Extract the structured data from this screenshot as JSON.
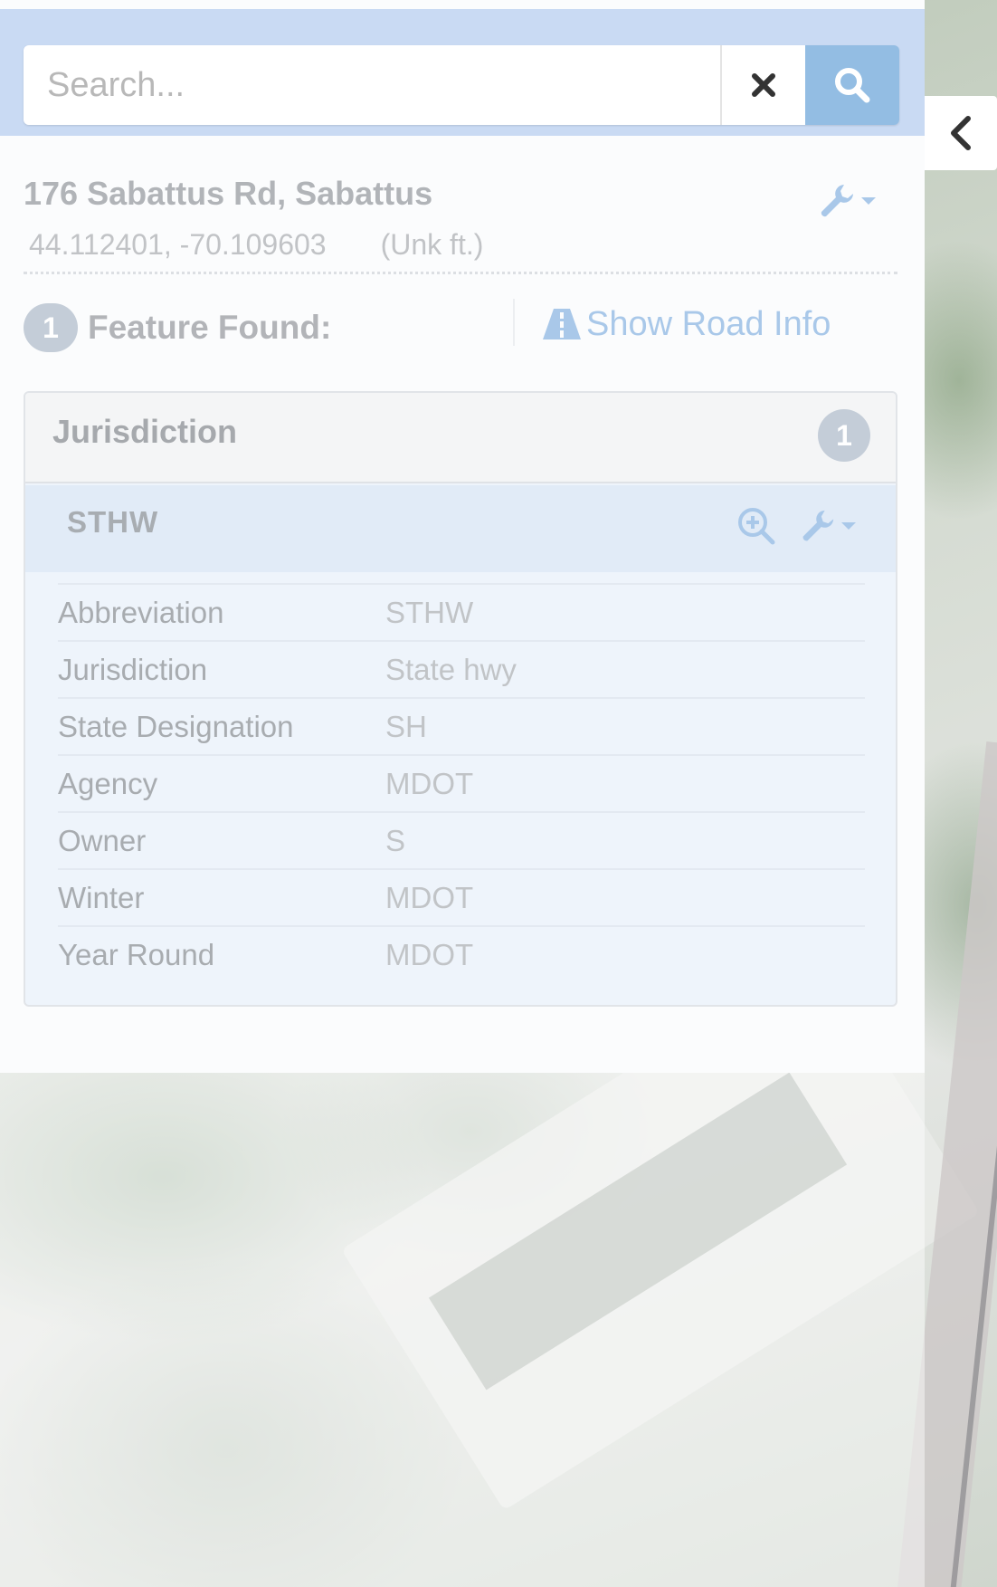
{
  "search": {
    "placeholder": "Search...",
    "clear_icon": "close-icon",
    "search_icon": "search-icon"
  },
  "location": {
    "address": "176 Sabattus Rd, Sabattus",
    "coordinates": "44.112401, -70.109603",
    "elevation": "(Unk ft.)",
    "tools_icon": "wrench-icon"
  },
  "features": {
    "count": "1",
    "label": "Feature Found:",
    "road_info_label": "Show Road Info",
    "road_info_icon": "road-icon"
  },
  "jurisdiction_card": {
    "title": "Jurisdiction",
    "count": "1",
    "item": {
      "title": "STHW",
      "zoom_icon": "zoom-in-icon",
      "tools_icon": "wrench-icon"
    },
    "rows": [
      {
        "label": "Abbreviation",
        "value": "STHW"
      },
      {
        "label": "Jurisdiction",
        "value": "State hwy"
      },
      {
        "label": "State Designation",
        "value": "SH"
      },
      {
        "label": "Agency",
        "value": "MDOT"
      },
      {
        "label": "Owner",
        "value": "S"
      },
      {
        "label": "Winter",
        "value": "MDOT"
      },
      {
        "label": "Year Round",
        "value": "MDOT"
      }
    ]
  },
  "panel_toggle": {
    "icon": "chevron-left-icon"
  },
  "colors": {
    "search_bar": "#c9daf3",
    "search_button": "#93bde3",
    "link": "#a9c8e9",
    "badge": "#c4cdd8"
  }
}
